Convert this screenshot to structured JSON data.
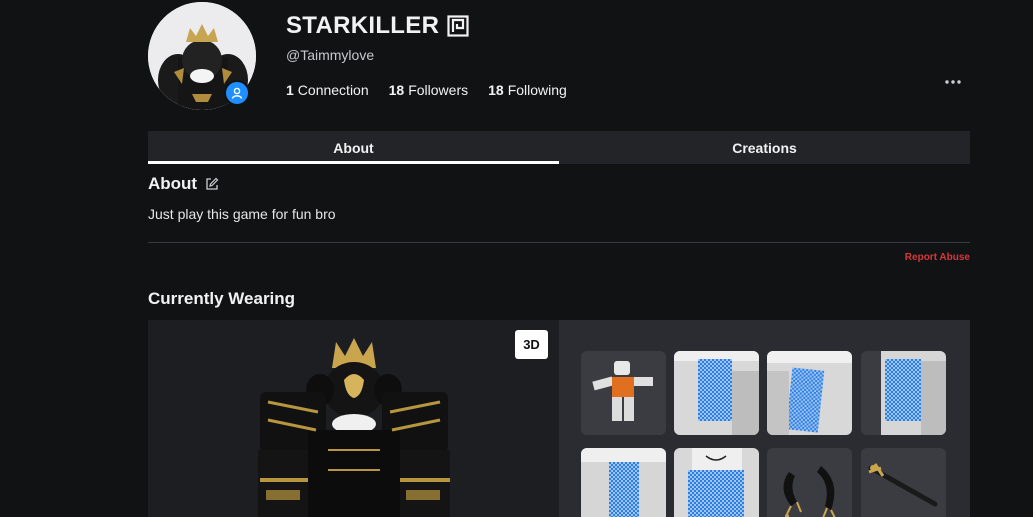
{
  "profile": {
    "display_name": "STARKILLER",
    "username": "@Taimmylove",
    "stats": [
      {
        "count": "1",
        "label": "Connection"
      },
      {
        "count": "18",
        "label": "Followers"
      },
      {
        "count": "18",
        "label": "Following"
      }
    ],
    "more_label": "•••"
  },
  "tabs": [
    {
      "label": "About",
      "active": true
    },
    {
      "label": "Creations",
      "active": false
    }
  ],
  "about": {
    "heading": "About",
    "text": "Just play this game for fun bro",
    "report_label": "Report Abuse"
  },
  "wearing": {
    "heading": "Currently Wearing",
    "view_toggle": "3D",
    "items": [
      {
        "icon": "avatar-figure-item"
      },
      {
        "icon": "blue-checker-torso-item"
      },
      {
        "icon": "blue-checker-torso-item"
      },
      {
        "icon": "blue-checker-arm-item"
      },
      {
        "icon": "blue-checker-arm-item"
      },
      {
        "icon": "smiley-face-torso-item"
      },
      {
        "icon": "black-horns-item"
      },
      {
        "icon": "black-sword-item"
      }
    ]
  },
  "colors": {
    "background": "#111214",
    "tab_bar": "#232428",
    "status_badge": "#1f8fff",
    "report_abuse": "#d23a3a",
    "checker_blue": "#2f7fe0"
  }
}
